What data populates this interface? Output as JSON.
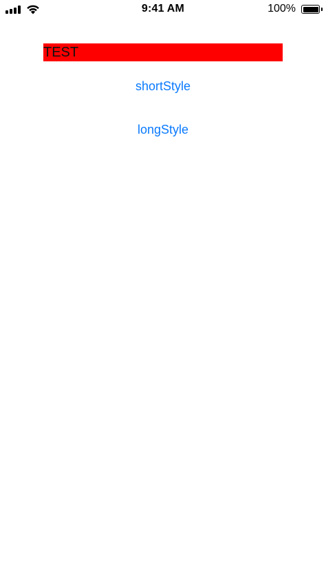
{
  "status_bar": {
    "time": "9:41 AM",
    "battery_percent": "100%",
    "signal_icon": "cellular-signal-icon",
    "wifi_icon": "wifi-icon",
    "battery_icon": "battery-icon",
    "battery_level": 1.0
  },
  "main": {
    "label_text": "TEST",
    "label_background": "#ff0000",
    "buttons": [
      {
        "label": "shortStyle"
      },
      {
        "label": "longStyle"
      }
    ],
    "button_color": "#0a7aff"
  }
}
